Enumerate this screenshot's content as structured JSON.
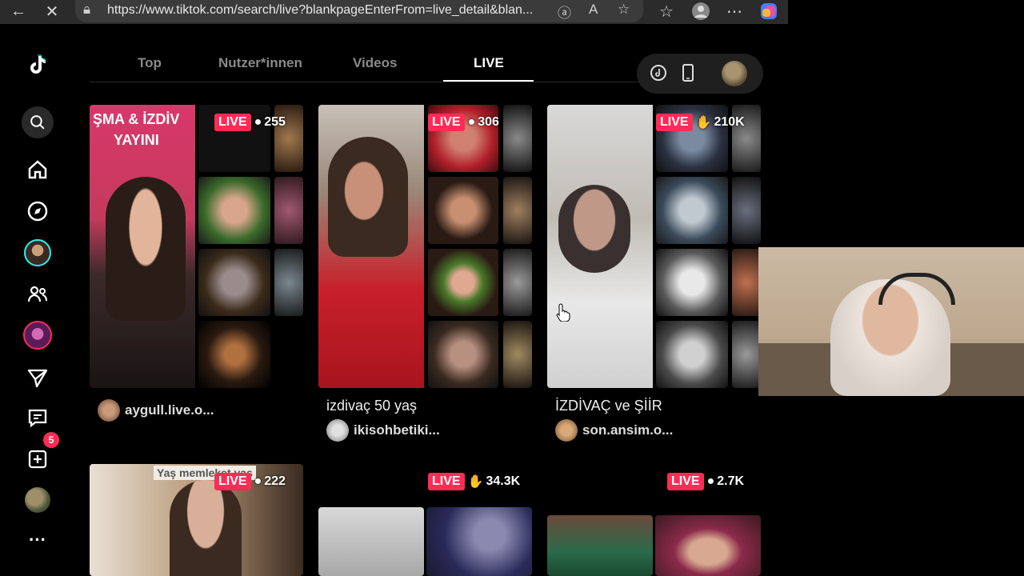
{
  "browser": {
    "url": "https://www.tiktok.com/search/live?blankpageEnterFrom=live_detail&blan..."
  },
  "sidebar": {
    "notification_count": "5"
  },
  "tabs": [
    "Top",
    "Nutzer*innen",
    "Videos",
    "LIVE"
  ],
  "active_tab": "LIVE",
  "cards": [
    {
      "live": "LIVE",
      "count": "255",
      "count_icon": "person-icon",
      "title": "",
      "user": "aygull.live.o...",
      "overlay_text": "YAYINI"
    },
    {
      "live": "LIVE",
      "count": "306",
      "count_icon": "person-icon",
      "title": "izdivaç 50 yaş",
      "user": "ikisohbetiki..."
    },
    {
      "live": "LIVE",
      "count": "210K",
      "count_icon": "like-icon",
      "title": "İZDİVAÇ ve ŞİİR",
      "user": "son.ansim.o..."
    },
    {
      "live": "LIVE",
      "count": "222",
      "count_icon": "person-icon",
      "overlay_text": "Yaş memleket yaş"
    },
    {
      "live": "LIVE",
      "count": "34.3K",
      "count_icon": "like-icon"
    },
    {
      "live": "LIVE",
      "count": "2.7K",
      "count_icon": "person-icon"
    }
  ],
  "overlays": {
    "card1_banner": "ŞMA & İZDİV"
  },
  "colors": {
    "accent": "#fe2c55",
    "background": "#000000"
  }
}
